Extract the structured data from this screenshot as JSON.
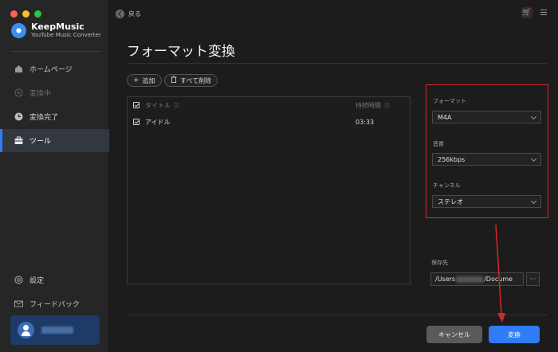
{
  "window": {
    "traffic_lights": [
      "#fe5f57",
      "#febc2e",
      "#28c840"
    ]
  },
  "app": {
    "name": "KeepMusic",
    "subtitle": "YouTube Music Converter"
  },
  "sidebar": {
    "items": [
      {
        "label": "ホームページ",
        "icon": "home-icon",
        "state": "normal"
      },
      {
        "label": "変換中",
        "icon": "converting-icon",
        "state": "disabled"
      },
      {
        "label": "変換完了",
        "icon": "clock-icon",
        "state": "normal"
      },
      {
        "label": "ツール",
        "icon": "toolbox-icon",
        "state": "active"
      }
    ],
    "bottom_items": [
      {
        "label": "設定",
        "icon": "gear-icon"
      },
      {
        "label": "フィードバック",
        "icon": "mail-icon"
      }
    ]
  },
  "header": {
    "back_label": "戻る"
  },
  "page": {
    "title": "フォーマット変換"
  },
  "toolbar": {
    "add_label": "追加",
    "delete_all_label": "すべて削除"
  },
  "table": {
    "columns": [
      "タイトル",
      "持続時間"
    ],
    "rows": [
      {
        "title": "アイドル",
        "duration": "03:33",
        "checked": true
      }
    ]
  },
  "settings": {
    "format_label": "フォーマット",
    "format_value": "M4A",
    "quality_label": "音質",
    "quality_value": "256kbps",
    "channel_label": "チャンネル",
    "channel_value": "ステレオ"
  },
  "output": {
    "label": "保存先",
    "path_prefix": "/Users",
    "path_suffix": "/Docume",
    "browse_label": "···"
  },
  "footer": {
    "cancel_label": "キャンセル",
    "convert_label": "変換"
  },
  "colors": {
    "accent": "#2f7cf6",
    "highlight_box": "#d62828",
    "annotation_arrow": "#d62828"
  }
}
